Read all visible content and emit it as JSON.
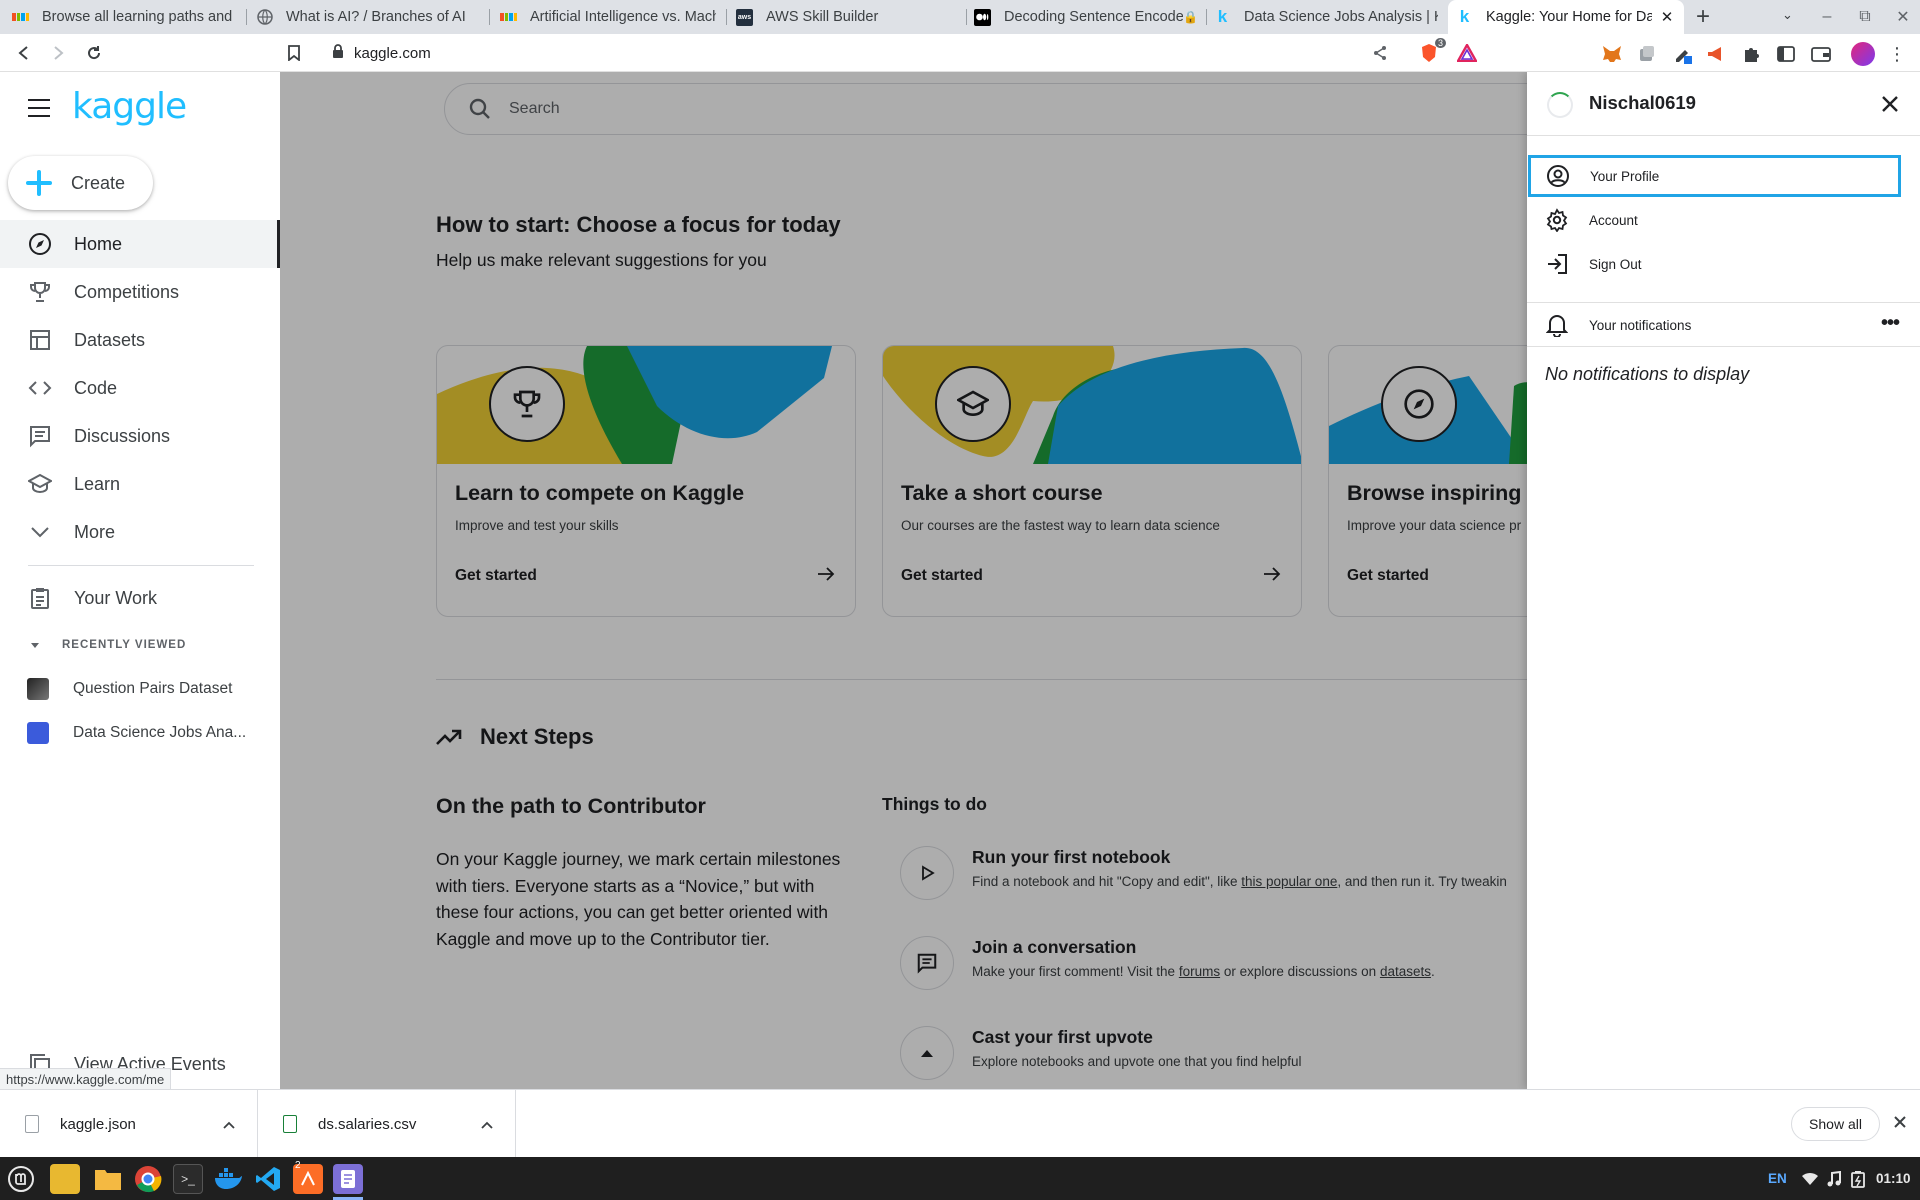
{
  "browser": {
    "tabs": [
      {
        "label": "Browse all learning paths and m",
        "icon": "microsoft-icon"
      },
      {
        "label": "What is AI? / Branches of AI",
        "icon": "globe-icon"
      },
      {
        "label": "Artificial Intelligence vs. Machi",
        "icon": "microsoft-icon"
      },
      {
        "label": "AWS Skill Builder",
        "icon": "aws-icon"
      },
      {
        "label": "Decoding Sentence Encoders",
        "icon": "medium-icon"
      },
      {
        "label": "Data Science Jobs Analysis | Ka",
        "icon": "kaggle-icon"
      },
      {
        "label": "Kaggle: Your Home for Dat",
        "icon": "kaggle-icon"
      }
    ],
    "url": "kaggle.com",
    "brave_badge": "3"
  },
  "sidebar": {
    "logo": "kaggle",
    "create_label": "Create",
    "nav": [
      {
        "label": "Home",
        "icon": "compass-icon"
      },
      {
        "label": "Competitions",
        "icon": "trophy-icon"
      },
      {
        "label": "Datasets",
        "icon": "table-icon"
      },
      {
        "label": "Code",
        "icon": "code-icon"
      },
      {
        "label": "Discussions",
        "icon": "discussion-icon"
      },
      {
        "label": "Learn",
        "icon": "school-icon"
      },
      {
        "label": "More",
        "icon": "chevron-down-icon"
      }
    ],
    "your_work": "Your Work",
    "recently_viewed_heading": "RECENTLY VIEWED",
    "recent": [
      {
        "label": "Question Pairs Dataset"
      },
      {
        "label": "Data Science Jobs Ana..."
      }
    ],
    "view_active_events": "View Active Events"
  },
  "main": {
    "search_placeholder": "Search",
    "heading": "How to start: Choose a focus for today",
    "subheading": "Help us make relevant suggestions for you",
    "cards": [
      {
        "title": "Learn to compete on Kaggle",
        "desc": "Improve and test your skills",
        "cta": "Get started"
      },
      {
        "title": "Take a short course",
        "desc": "Our courses are the fastest way to learn data science",
        "cta": "Get started"
      },
      {
        "title": "Browse inspiring",
        "desc": "Improve your data science pr",
        "cta": "Get started"
      }
    ],
    "next_steps": "Next Steps",
    "path_title": "On the path to Contributor",
    "path_text": "On your Kaggle journey, we mark certain milestones with tiers. Everyone starts as a “Novice,” but with these four actions, you can get better oriented with Kaggle and move up to the Contributor tier.",
    "things_to_do": "Things to do",
    "todos": [
      {
        "title": "Run your first notebook",
        "desc_a": "Find a notebook and hit \"Copy and edit\", like ",
        "link1": "this popular one",
        "desc_b": ", and then run it. Try tweakin",
        "link2": "",
        "desc_c": ""
      },
      {
        "title": "Join a conversation",
        "desc_a": "Make your first comment! Visit the ",
        "link1": "forums",
        "desc_b": " or explore discussions on ",
        "link2": "datasets",
        "desc_c": "."
      },
      {
        "title": "Cast your first upvote",
        "desc_a": "Explore notebooks and upvote one that you find helpful",
        "link1": "",
        "desc_b": "",
        "link2": "",
        "desc_c": ""
      }
    ]
  },
  "panel": {
    "username": "Nischal0619",
    "items": [
      {
        "label": "Your Profile",
        "icon": "profile-icon"
      },
      {
        "label": "Account",
        "icon": "gear-icon"
      },
      {
        "label": "Sign Out",
        "icon": "sign-out-icon"
      }
    ],
    "notifications_label": "Your notifications",
    "no_notifications": "No notifications to display"
  },
  "status_url": "https://www.kaggle.com/me",
  "downloads": {
    "items": [
      {
        "name": "kaggle.json"
      },
      {
        "name": "ds.salaries.csv"
      }
    ],
    "show_all": "Show all"
  },
  "taskbar": {
    "lang": "EN",
    "time": "01:10",
    "badge": "2"
  },
  "colors": {
    "kaggle_blue": "#20beff",
    "focus_outline": "#20a4e6",
    "art_yellow": "#f0d035",
    "art_green": "#1f9e3f",
    "art_blue": "#1aa7e8"
  }
}
